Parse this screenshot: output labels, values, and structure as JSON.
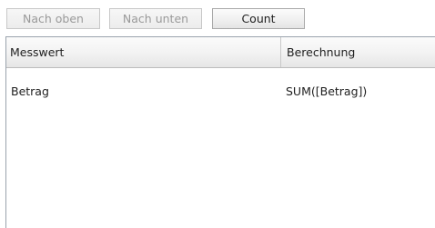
{
  "toolbar": {
    "move_up_label": "Nach oben",
    "move_down_label": "Nach unten",
    "count_label": "Count"
  },
  "table": {
    "columns": [
      "Messwert",
      "Berechnung"
    ],
    "rows": [
      [
        "Betrag",
        "SUM([Betrag])"
      ]
    ]
  },
  "colors": {
    "disabled_text": "#9a9a9a",
    "border": "#9aa3ad",
    "header_bg": "#f3f3f3"
  }
}
